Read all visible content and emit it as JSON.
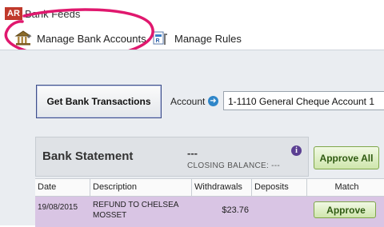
{
  "window": {
    "logo": "AR",
    "title": "Bank Feeds"
  },
  "toolbar": {
    "manage_bank_accounts": "Manage Bank Accounts",
    "manage_rules": "Manage Rules"
  },
  "actions": {
    "get_transactions": "Get Bank Transactions"
  },
  "account": {
    "label": "Account",
    "value": "1-1110 General Cheque Account 1"
  },
  "statement": {
    "title": "Bank Statement",
    "amount": "---",
    "closing_balance": "CLOSING BALANCE: ---",
    "approve_all": "Approve All"
  },
  "table": {
    "columns": [
      "Date",
      "Description",
      "Withdrawals",
      "Deposits",
      "Match"
    ],
    "rows": [
      {
        "date": "19/08/2015",
        "description": "REFUND TO CHELSEA MOSSET",
        "withdrawals": "$23.76",
        "deposits": "",
        "match_action": "Approve"
      }
    ]
  },
  "colors": {
    "annotation": "#e0186e",
    "row_highlight": "#d9c5e4",
    "approve_green": "#7fa64a"
  },
  "icons": [
    "bank-icon",
    "rules-icon",
    "arrow-right-icon",
    "info-icon"
  ]
}
